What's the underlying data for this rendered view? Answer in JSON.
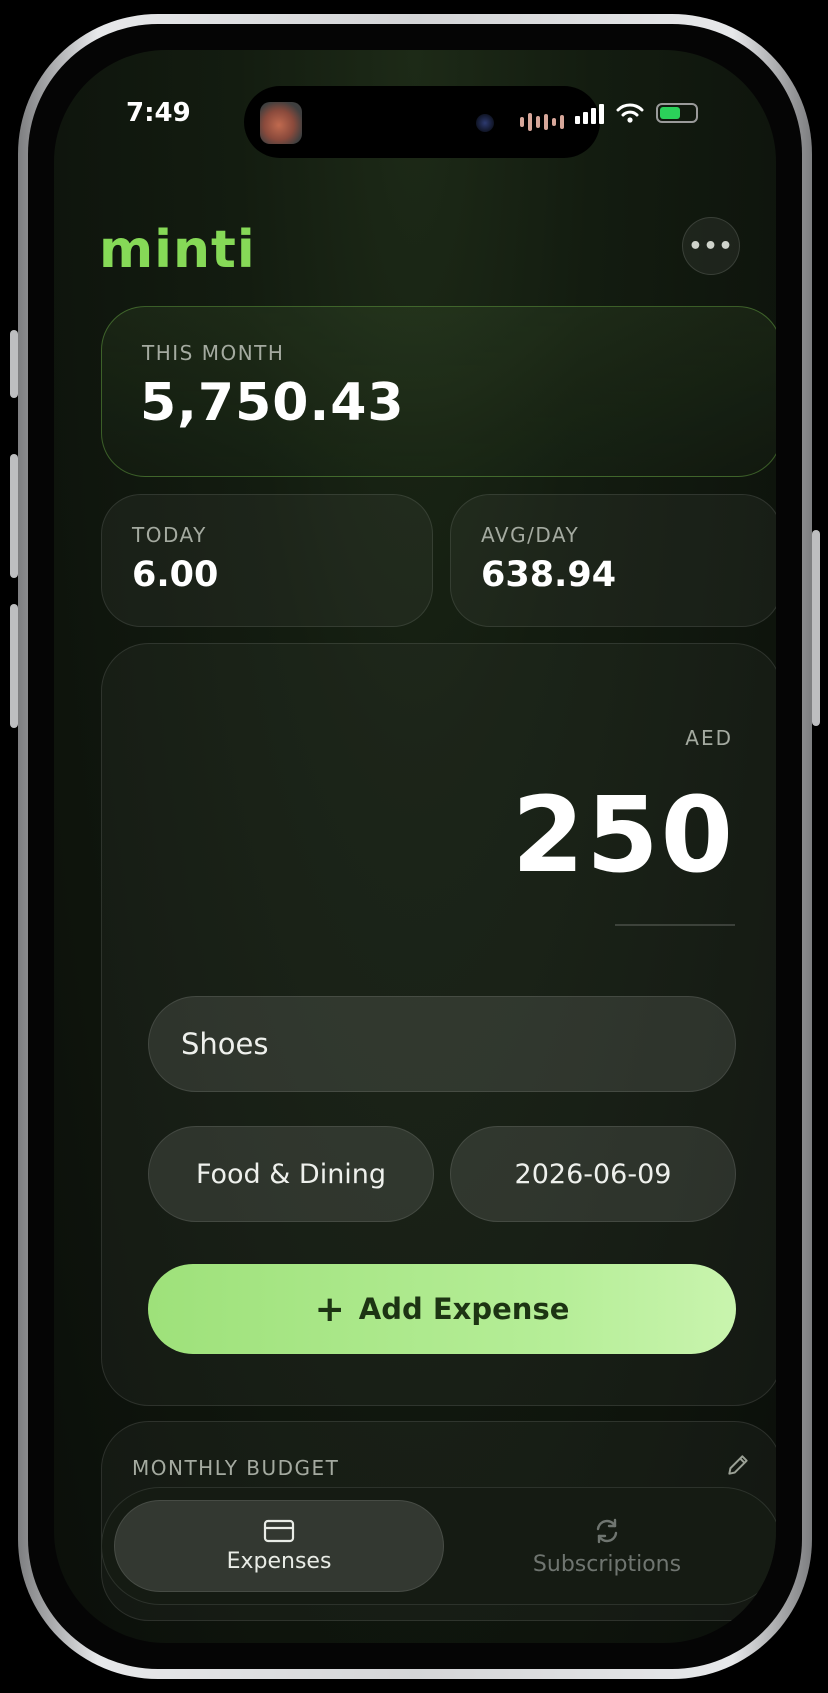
{
  "status_bar": {
    "time": "7:49",
    "battery_color": "#2bd15a",
    "icons": [
      "signal-icon",
      "wifi-icon",
      "battery-icon"
    ]
  },
  "app": {
    "logo": "minti",
    "more_label": "•••",
    "accent": "#86d957"
  },
  "summary": {
    "month_label": "THIS MONTH",
    "month_value": "5,750.43",
    "today_label": "TODAY",
    "today_value": "6.00",
    "avg_label": "AVG/DAY",
    "avg_value": "638.94"
  },
  "entry": {
    "currency": "AED",
    "amount": "250",
    "description": "Shoes",
    "category": "Food & Dining",
    "date": "2026-06-09",
    "add_button_icon": "+",
    "add_button_label": "Add Expense"
  },
  "budget": {
    "label": "MONTHLY BUDGET",
    "edit_icon": "pencil-icon"
  },
  "tabs": [
    {
      "label": "Expenses",
      "icon": "card-icon",
      "active": true
    },
    {
      "label": "Subscriptions",
      "icon": "refresh-icon",
      "active": false
    }
  ]
}
